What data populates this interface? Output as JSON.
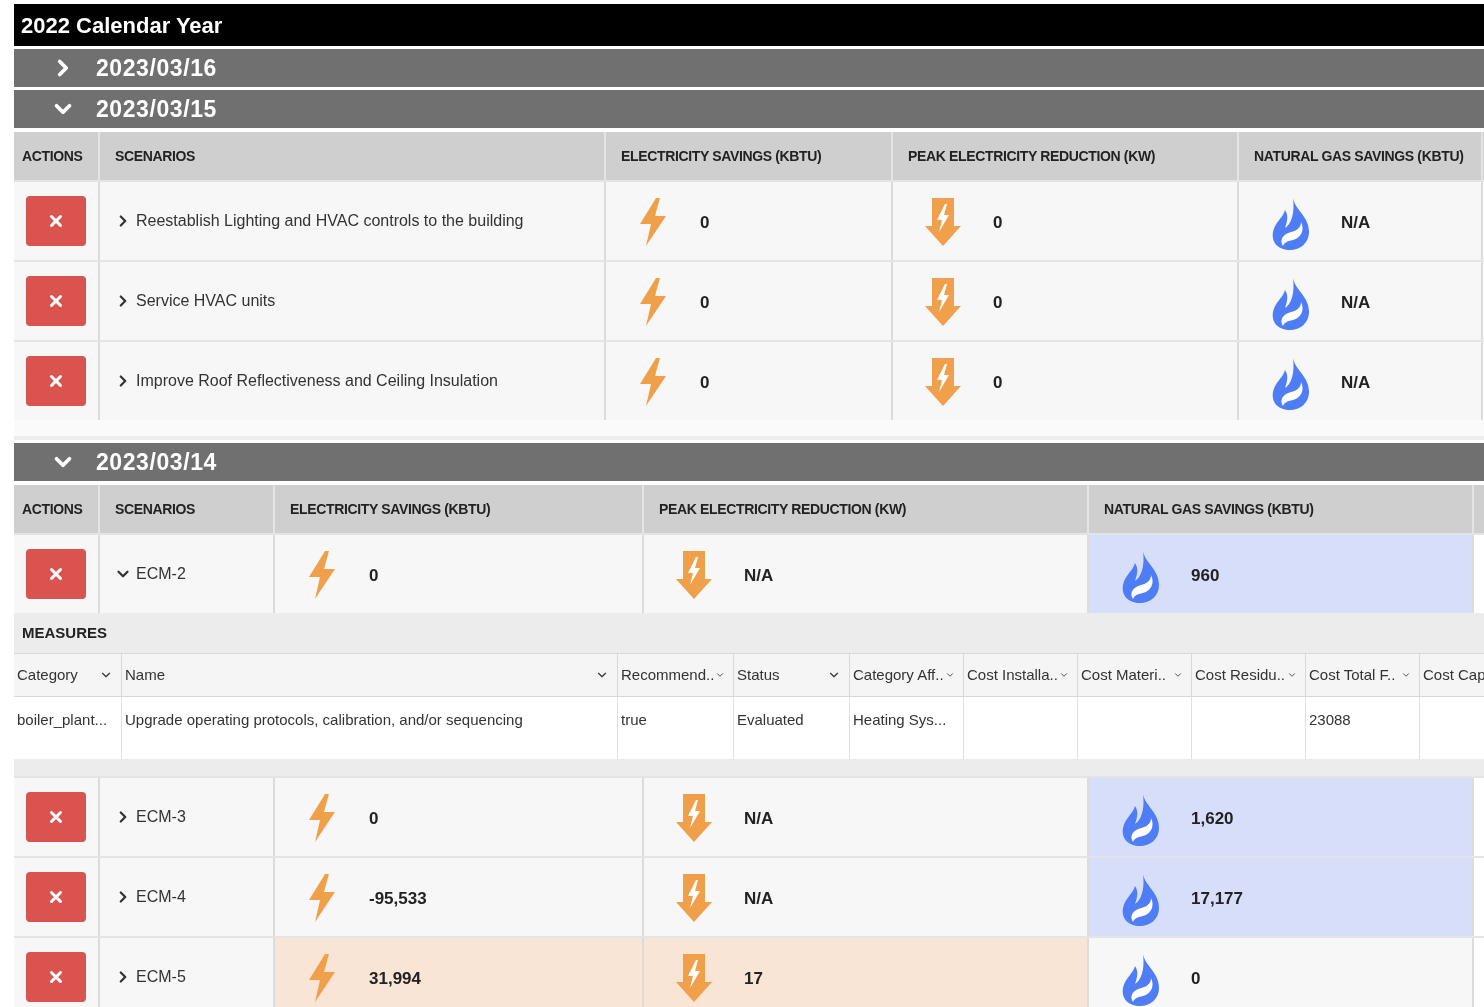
{
  "title": "2022 Calendar Year",
  "groups": [
    {
      "date": "2023/03/16",
      "expanded": false
    },
    {
      "date": "2023/03/15",
      "expanded": true,
      "columns": [
        "ACTIONS",
        "SCENARIOS",
        "ELECTRICITY SAVINGS (KBTU)",
        "PEAK ELECTRICITY REDUCTION (KW)",
        "NATURAL GAS SAVINGS (KBTU)"
      ],
      "rows": [
        {
          "scenario": "Reestablish Lighting and HVAC controls to the building",
          "expanded": false,
          "electricity": {
            "value": "0",
            "highlighted": false
          },
          "peak": {
            "value": "0",
            "highlighted": false
          },
          "gas": {
            "value": "N/A",
            "highlighted": false
          }
        },
        {
          "scenario": "Service HVAC units",
          "expanded": false,
          "electricity": {
            "value": "0",
            "highlighted": false
          },
          "peak": {
            "value": "0",
            "highlighted": false
          },
          "gas": {
            "value": "N/A",
            "highlighted": false
          }
        },
        {
          "scenario": "Improve Roof Reflectiveness and Ceiling Insulation",
          "expanded": false,
          "electricity": {
            "value": "0",
            "highlighted": false
          },
          "peak": {
            "value": "0",
            "highlighted": false
          },
          "gas": {
            "value": "N/A",
            "highlighted": false
          }
        }
      ]
    },
    {
      "date": "2023/03/14",
      "expanded": true,
      "columns": [
        "ACTIONS",
        "SCENARIOS",
        "ELECTRICITY SAVINGS (KBTU)",
        "PEAK ELECTRICITY REDUCTION (KW)",
        "NATURAL GAS SAVINGS (KBTU)"
      ],
      "rows": [
        {
          "scenario": "ECM-2",
          "expanded": true,
          "electricity": {
            "value": "0",
            "highlighted": false
          },
          "peak": {
            "value": "N/A",
            "highlighted": false
          },
          "gas": {
            "value": "960",
            "highlighted": true
          },
          "measures": {
            "label": "MEASURES",
            "columns": [
              {
                "label": "Category",
                "kind": "dropdown"
              },
              {
                "label": "Name",
                "kind": "dropdown"
              },
              {
                "label": "Recommend..",
                "kind": "filter"
              },
              {
                "label": "Status",
                "kind": "dropdown"
              },
              {
                "label": "Category Aff..",
                "kind": "filter"
              },
              {
                "label": "Cost Installa..",
                "kind": "filter"
              },
              {
                "label": "Cost Materi..",
                "kind": "filter"
              },
              {
                "label": "Cost Residu..",
                "kind": "filter"
              },
              {
                "label": "Cost Total F..",
                "kind": "filter"
              },
              {
                "label": "Cost Cap",
                "kind": "plain"
              }
            ],
            "rows": [
              [
                "boiler_plant...",
                "Upgrade operating protocols, calibration, and/or sequencing",
                "true",
                "Evaluated",
                "Heating Sys...",
                null,
                null,
                null,
                "23088",
                null
              ]
            ]
          }
        },
        {
          "scenario": "ECM-3",
          "expanded": false,
          "electricity": {
            "value": "0",
            "highlighted": false
          },
          "peak": {
            "value": "N/A",
            "highlighted": false
          },
          "gas": {
            "value": "1,620",
            "highlighted": true
          }
        },
        {
          "scenario": "ECM-4",
          "expanded": false,
          "electricity": {
            "value": "-95,533",
            "highlighted": false
          },
          "peak": {
            "value": "N/A",
            "highlighted": false
          },
          "gas": {
            "value": "17,177",
            "highlighted": true
          }
        },
        {
          "scenario": "ECM-5",
          "expanded": false,
          "electricity": {
            "value": "31,994",
            "highlighted": true
          },
          "peak": {
            "value": "17",
            "highlighted": true
          },
          "gas": {
            "value": "0",
            "highlighted": false
          }
        }
      ]
    }
  ]
}
